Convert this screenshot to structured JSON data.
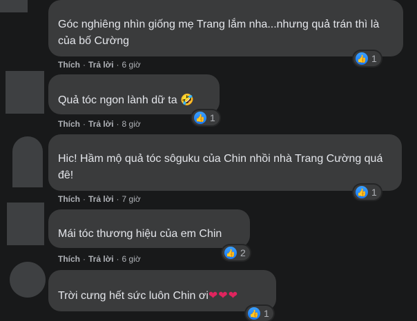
{
  "comments": [
    {
      "text": "Góc nghiêng nhìn giống mẹ Trang lắm nha...nhưng quả trán thì là của bố Cường",
      "like_label": "Thích",
      "reply_label": "Trả lời",
      "time": "6 giờ",
      "reaction_count": "1"
    },
    {
      "text": "Quả tóc ngon lành dữ ta",
      "emoji": "🤣",
      "like_label": "Thích",
      "reply_label": "Trả lời",
      "time": "8 giờ",
      "reaction_count": "1"
    },
    {
      "text": "Hic! Hầm mộ quả tóc sôguku của Chin nhồi nhà Trang Cường quá đê!",
      "like_label": "Thích",
      "reply_label": "Trả lời",
      "time": "7 giờ",
      "reaction_count": "1"
    },
    {
      "text": "Mái tóc thương hiệu của em Chin",
      "like_label": "Thích",
      "reply_label": "Trả lời",
      "time": "6 giờ",
      "reaction_count": "2"
    },
    {
      "text": "Trời cưng hết sức luôn Chin ơi",
      "hearts": "❤❤❤",
      "reaction_count": "1"
    }
  ],
  "separator": "·",
  "colors": {
    "background": "#18191a",
    "bubble": "#3a3b3c",
    "text": "#e4e6eb",
    "meta": "#b0b3b8",
    "like_blue": "#1877f2"
  },
  "icons": {
    "reaction": "like-thumb-icon"
  }
}
